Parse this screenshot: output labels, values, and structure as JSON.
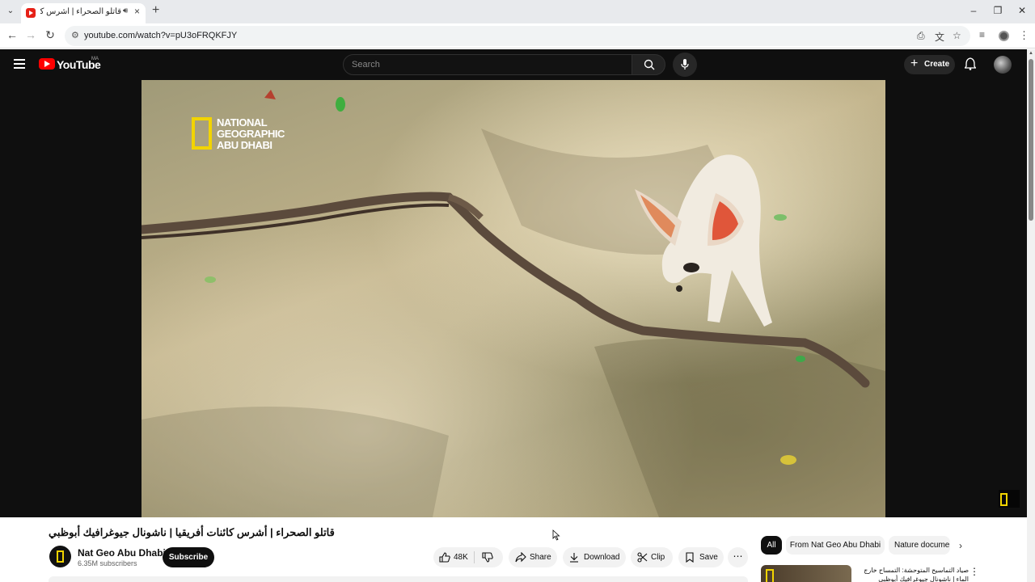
{
  "browser": {
    "tab_title": "قاتلو الصحراء | أشرس كائنات",
    "audio_icon": "speaker-icon",
    "url": "youtube.com/watch?v=pU3oFRQKFJY"
  },
  "masthead": {
    "logo_text": "YouTube",
    "country_code": "MA",
    "search_placeholder": "Search",
    "create_label": "Create"
  },
  "video": {
    "overlay_logo": [
      "NATIONAL",
      "GEOGRAPHIC",
      "ABU DHABI"
    ],
    "title": "قاتلو الصحراء | أشرس كائنات أفريقيا | ناشونال جيوغرافيك أبوظبي"
  },
  "channel": {
    "name": "Nat Geo Abu Dhabi",
    "subscribers": "6.35M subscribers",
    "subscribe_label": "Subscribe"
  },
  "actions": {
    "likes": "48K",
    "share": "Share",
    "download": "Download",
    "clip": "Clip",
    "save": "Save"
  },
  "chips": [
    "All",
    "From Nat Geo Abu Dhabi",
    "Nature documen"
  ],
  "recommended": {
    "title": "صياد التماسيح المتوحشة: التمساح خارج الماء | ناشونال جيوغرافيك أبوظبي"
  },
  "colors": {
    "youtube_red": "#ff0000",
    "natgeo_yellow": "#f2d400",
    "dark_bg": "#0f0f0f"
  }
}
